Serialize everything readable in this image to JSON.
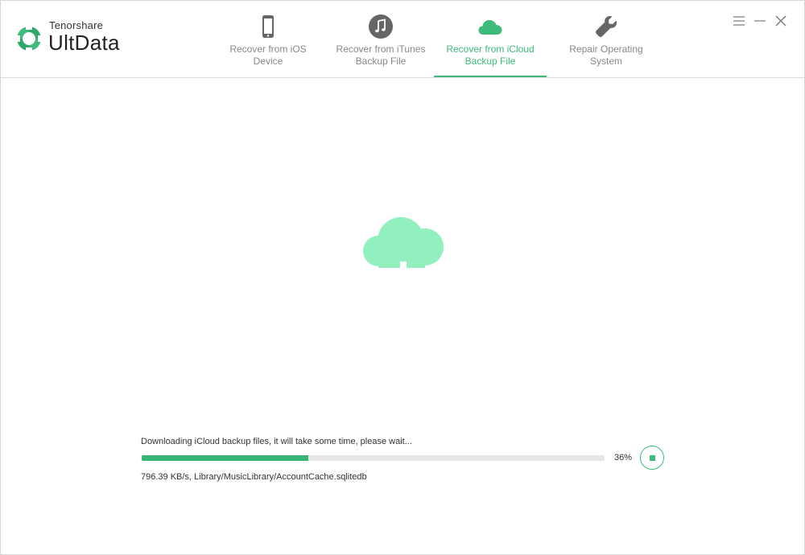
{
  "app": {
    "brand_small": "Tenorshare",
    "brand_big": "UltData",
    "accent_color": "#3dbb7a"
  },
  "tabs": [
    {
      "label": "Recover from iOS\nDevice",
      "icon": "iphone-icon",
      "active": false
    },
    {
      "label": "Recover from iTunes\nBackup File",
      "icon": "music-note-icon",
      "active": false
    },
    {
      "label": "Recover from iCloud\nBackup File",
      "icon": "cloud-icon",
      "active": true
    },
    {
      "label": "Repair Operating\nSystem",
      "icon": "wrench-icon",
      "active": false
    }
  ],
  "window_controls": [
    "menu-icon",
    "minimize-icon",
    "close-icon"
  ],
  "main": {
    "center_icon": "cloud-icon",
    "status_text": "Downloading iCloud backup files, it will take some time, please wait...",
    "progress_percent": 36,
    "progress_label": "36%",
    "file_info": "796.39 KB/s, Library/MusicLibrary/AccountCache.sqlitedb",
    "stop_icon": "stop-icon"
  }
}
